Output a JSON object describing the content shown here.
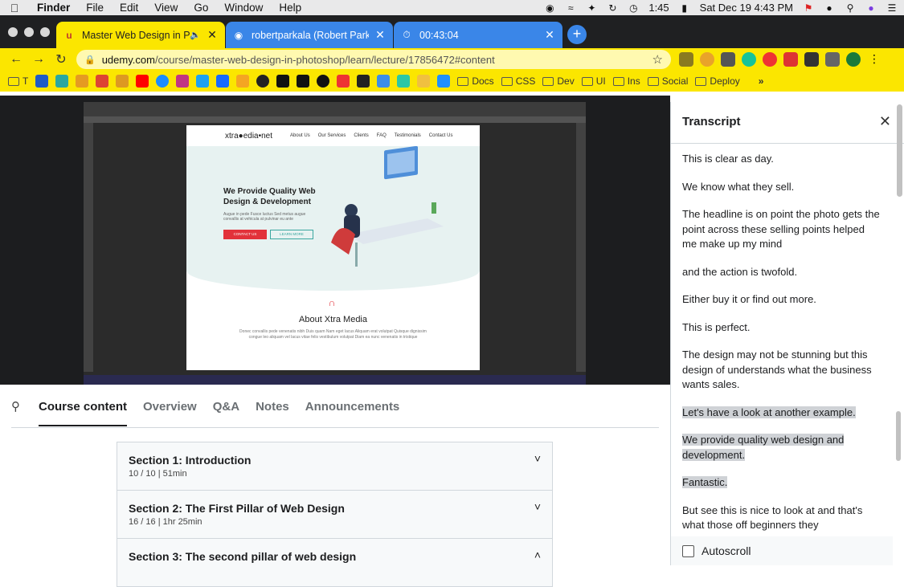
{
  "menubar": {
    "app": "Finder",
    "items": [
      "File",
      "Edit",
      "View",
      "Go",
      "Window",
      "Help"
    ],
    "time": "1:45",
    "datetime": "Sat Dec 19  4:43 PM"
  },
  "tabs": [
    {
      "title": "Master Web Design in Phot",
      "active": true
    },
    {
      "title": "robertparkala (Robert Parkala)",
      "active": false
    },
    {
      "title": "00:43:04",
      "active": false
    }
  ],
  "address": {
    "host": "udemy.com",
    "path": "/course/master-web-design-in-photoshop/learn/lecture/17856472#content"
  },
  "bookmarks": {
    "first_label": "T",
    "folders": [
      "Docs",
      "CSS",
      "Dev",
      "UI",
      "Ins",
      "Social",
      "Deploy"
    ]
  },
  "video": {
    "site_logo": "xtra●edia•net",
    "site_nav": [
      "About Us",
      "Our Services",
      "Clients",
      "FAQ",
      "Testimonials",
      "Contact Us"
    ],
    "hero_heading": "We Provide Quality Web Design & Development",
    "hero_text": "Augue in pede Fusce luctus Sed metus augue convallis at vehicula at pulvinar eu ante",
    "cta_primary": "CONTACT US",
    "cta_secondary": "LEARN MORE",
    "about_heading": "About Xtra Media",
    "about_text": "Donec convallis pede venenatis nibh Duis quam Nam eget lacus Aliquam erat volutpat Quisque dignissim congue leo aliquam vel lacus vitae felis vestibulum volutpat Diam ea nunc venenatis in tristique"
  },
  "course_tabs": [
    "Course content",
    "Overview",
    "Q&A",
    "Notes",
    "Announcements"
  ],
  "sections": [
    {
      "title": "Section 1: Introduction",
      "meta": "10 / 10 | 51min",
      "chevron": "˅"
    },
    {
      "title": "Section 2: The First Pillar of Web Design",
      "meta": "16 / 16 | 1hr 25min",
      "chevron": "˅"
    },
    {
      "title": "Section 3: The second pillar of web design",
      "meta": "",
      "chevron": "˄"
    }
  ],
  "transcript": {
    "title": "Transcript",
    "cues": [
      {
        "text": "This is clear as day.",
        "highlight": false
      },
      {
        "text": "We know what they sell.",
        "highlight": false
      },
      {
        "text": "The headline is on point the photo gets the point across these selling points helped me make up my mind",
        "highlight": false
      },
      {
        "text": "and the action is twofold.",
        "highlight": false
      },
      {
        "text": "Either buy it or find out more.",
        "highlight": false
      },
      {
        "text": "This is perfect.",
        "highlight": false
      },
      {
        "text": "The design may not be stunning but this design of understands what the business wants sales.",
        "highlight": false
      },
      {
        "text": "Let's have a look at another example.",
        "highlight": true
      },
      {
        "text": "We provide quality web design and development.",
        "highlight": true
      },
      {
        "text": "Fantastic.",
        "highlight": true
      },
      {
        "text": "But see this is nice to look at and that's what those off beginners they",
        "highlight": false
      }
    ],
    "autoscroll_label": "Autoscroll"
  }
}
